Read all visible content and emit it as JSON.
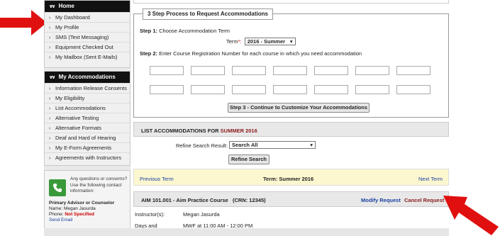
{
  "sidebar": {
    "home": {
      "title": "Home",
      "items": [
        {
          "label": "My Dashboard"
        },
        {
          "label": "My Profile"
        },
        {
          "label": "SMS (Text Messaging)"
        },
        {
          "label": "Equipment Checked Out"
        },
        {
          "label": "My Mailbox (Sent E-Mails)"
        }
      ]
    },
    "accommodations": {
      "title": "My Accommodations",
      "items": [
        {
          "label": "Information Release Consents"
        },
        {
          "label": "My Eligibility"
        },
        {
          "label": "List Accommodations"
        },
        {
          "label": "Alternative Testing"
        },
        {
          "label": "Alternative Formats"
        },
        {
          "label": "Deaf and Hard of Hearing"
        },
        {
          "label": "My E-Form Agreements"
        },
        {
          "label": "Agreements with Instructors"
        }
      ]
    },
    "contact": {
      "question": "Any questions or concerns? Use the following contact information:",
      "role": "Primary Advisor or Counselor",
      "name_label": "Name:",
      "name": "Megan Jasurda",
      "phone_label": "Phone:",
      "phone": "Not Specified",
      "email_link": "Send Email"
    }
  },
  "steps": {
    "legend": "3 Step Process to Request Accommodations",
    "step1_label": "Step 1:",
    "step1_text": "Choose Accommodation Term",
    "term_label": "Term",
    "term_required": "*:",
    "term_value": "2016 - Summer",
    "step2_label": "Step 2:",
    "step2_text": "Enter Course Registration Number for each course in which you need accommodation",
    "step3_button": "Step 3 - Continue to Customize Your Accommodations"
  },
  "list": {
    "title": "LIST ACCOMMODATIONS FOR",
    "term": "SUMMER 2016",
    "refine_label": "Refine Search Result:",
    "refine_value": "Search All",
    "refine_button": "Refine Search"
  },
  "term_nav": {
    "prev": "Previous Term",
    "current": "Term: Summer 2016",
    "next": "Next Term"
  },
  "course": {
    "title": "AIM 101.001 - Aim Practice Course",
    "crn": "(CRN: 12345)",
    "modify": "Modify Request",
    "cancel": "Cancel Request",
    "instructor_label": "Instructor(s):",
    "instructor": "Megan Jasurda",
    "days_label": "Days and Time(s):",
    "days": "MWF at 11:00 AM - 12:00 PM"
  },
  "colors": {
    "arrow": "#e01010",
    "header": "#111111",
    "term_accent": "#8b1a1a",
    "link": "#1a3fa0",
    "term_bar": "#fdf7d0"
  }
}
